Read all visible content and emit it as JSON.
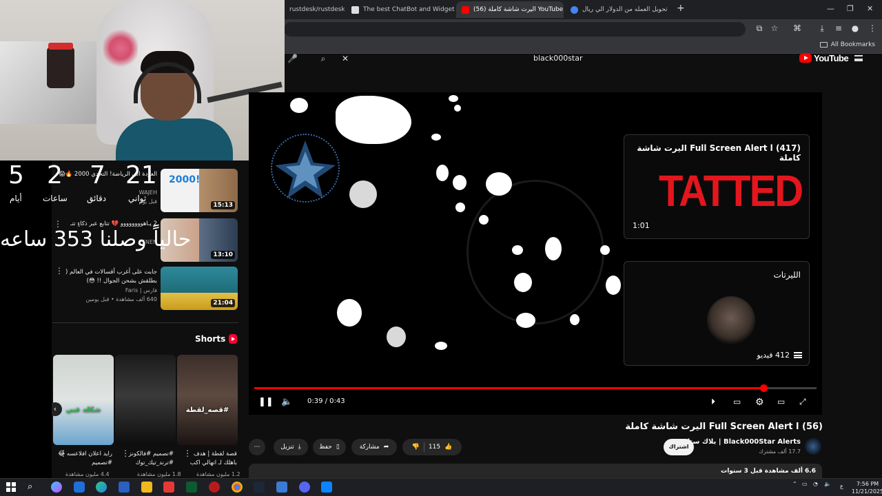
{
  "browser": {
    "tabs": [
      {
        "label": "rustdesk/rustdesk"
      },
      {
        "label": "The best ChatBot and Widgets"
      },
      {
        "label": "(56) اليرت شاشة كاملة YouTube"
      },
      {
        "label": "تحويل العمله من الدولار الي ريال"
      }
    ],
    "new_tab": "+",
    "bookmarks_all": "All Bookmarks"
  },
  "youtube": {
    "search_value": "black000star",
    "logo_text": "YouTube"
  },
  "overlay": {
    "countdown": [
      {
        "value": "5",
        "label": "أيام"
      },
      {
        "value": "2",
        "label": "ساعات"
      },
      {
        "value": "7",
        "label": "دقائق"
      },
      {
        "value": "21",
        "label": "ثواني"
      }
    ],
    "big_text": "حالياً وصلنا 353 ساعه"
  },
  "recommendations": [
    {
      "title": "العودة الى الرياضة! التحدي 2000 🔥😱",
      "channel": "WAJEH",
      "meta": "قبل يوم",
      "duration": "15:13"
    },
    {
      "title": "2 يـاهوووووووو 💔 تتابع عبر ذكاءٍ تتـ",
      "channel": "7SNEN",
      "meta": "",
      "duration": "13:10"
    },
    {
      "title": "جابت على أغرب أقسالات في العالم ( بطلقش بشحن الجوال !! 😳)",
      "channel": "فارس | Faris",
      "meta": "640 ألف مشاهدة • قبل يومين",
      "duration": "21:04"
    }
  ],
  "shorts": {
    "heading": "Shorts",
    "items": [
      {
        "caption": "شكله غني",
        "title": "رايد اعلان افلاعسه 😂 #تصميم",
        "views": "4.4 مليون مشاهدة"
      },
      {
        "caption": "",
        "title": "#تصميم #فالكونز #ترند_تيك_توك",
        "views": "1.8 مليون مشاهدة"
      },
      {
        "caption": "#قصه_لقطة",
        "title": "قصة لقطة | هدف باهلك لـ اتهالي اكب",
        "views": "1.2 مليون مشاهدة"
      }
    ]
  },
  "player": {
    "endcards": [
      {
        "title": "Full Screen Alert l (417) اليرت شاشة كاملة",
        "duration": "1:01",
        "thumb_text": "TATTED"
      },
      {
        "title": "الليرتات",
        "count": "412 فيديو"
      }
    ],
    "time": "0:39 / 0:43",
    "progress": 0.906
  },
  "video": {
    "title": "Full Screen Alert l (56) اليرت شاشة كاملة",
    "channel": "Black000Star Alerts | بلاك ستار",
    "subs": "17.7 ألف مشترك",
    "subscribe": "اشتراك",
    "likes": "115",
    "share": "مشاركة",
    "save": "حفظ",
    "download": "تنزيل",
    "description": "6.6 ألف مشاهدة  قبل 3 سنوات"
  },
  "taskbar": {
    "time": "7:56 PM",
    "date": "11/21/2025",
    "lang": "ع"
  }
}
